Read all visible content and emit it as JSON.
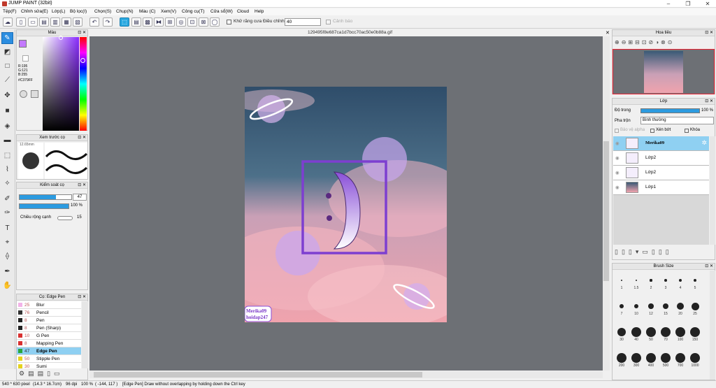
{
  "app": {
    "title": "JUMP PAINT (32bit)"
  },
  "menu": [
    "Tệp(F)",
    "Chỉnh sửa(E)",
    "Lớp(L)",
    "Bộ lọc(I)",
    "Chọn(S)",
    "Chụp(N)",
    "Màu (C)",
    "Xem(V)",
    "Công cụ(T)",
    "Cửa sổ(W)",
    "Cloud",
    "Help"
  ],
  "toolbar": {
    "antialias_label": "Khử răng cưa",
    "adjust_label": "Điều chỉnh",
    "adjust_value": "40",
    "warning_label": "Cảnh báo"
  },
  "document": {
    "filename": "129495f8e687ca1d7bcc70ac50e0b88a.gif",
    "watermark_line1": "Merika09",
    "watermark_line2": "hoidap247"
  },
  "color_panel": {
    "title": "Màu",
    "r": "R:195",
    "g": "G:121",
    "b": "B:255",
    "hex": "#C379FF",
    "accent": "#c379ff"
  },
  "preview_panel": {
    "title": "Xem trước cọ",
    "size": "12.65mm"
  },
  "brush_control": {
    "title": "Kiểm soát cọ",
    "size_value": "47",
    "opacity_value": "100 %",
    "edge_label": "Chiều rộng cạnh",
    "edge_value": "15"
  },
  "brush_list": {
    "title": "Cọ: Edge Pen",
    "items": [
      {
        "num": "25",
        "name": "Blur",
        "color": "#f3b3e8"
      },
      {
        "num": "76",
        "name": "Pencil",
        "color": "#333333"
      },
      {
        "num": "8",
        "name": "Pen",
        "color": "#222222"
      },
      {
        "num": "8",
        "name": "Pen (Sharp)",
        "color": "#222222"
      },
      {
        "num": "10",
        "name": "G Pen",
        "color": "#d93030"
      },
      {
        "num": "8",
        "name": "Mapping Pen",
        "color": "#d93030"
      },
      {
        "num": "47",
        "name": "Edge Pen",
        "color": "#2aa63a"
      },
      {
        "num": "50",
        "name": "Stipple Pen",
        "color": "#e5d21e"
      },
      {
        "num": "30",
        "name": "Sumi",
        "color": "#e5d21e"
      }
    ]
  },
  "navigator": {
    "title": "Hoa tiêu"
  },
  "layers": {
    "title": "Lớp",
    "opacity_label": "Độ trong",
    "opacity_value": "100 %",
    "blend_label": "Pha trộn",
    "blend_value": "Bình thường",
    "protect_alpha": "Bảo vệ alpha",
    "clipping": "Xén bớt",
    "lock": "Khóa",
    "items": [
      {
        "name": "Merika09",
        "selected": true
      },
      {
        "name": "Lớp2"
      },
      {
        "name": "Lớp2"
      },
      {
        "name": "Lớp1"
      }
    ]
  },
  "brush_size": {
    "title": "Brush Size",
    "sizes": [
      "1",
      "1.5",
      "2",
      "3",
      "4",
      "5",
      "7",
      "10",
      "12",
      "15",
      "20",
      "25",
      "30",
      "40",
      "50",
      "70",
      "100",
      "150",
      "200",
      "300",
      "400",
      "500",
      "700",
      "1000"
    ]
  },
  "status": {
    "dimensions": "540 * 630 pixel",
    "physical": "(14.3 * 16.7cm)",
    "dpi": "96 dpi",
    "zoom": "100 %",
    "coords": "( -144, 117 )",
    "hint": "[Edge Pen] Draw without overlapping by holding down the Ctrl key"
  }
}
